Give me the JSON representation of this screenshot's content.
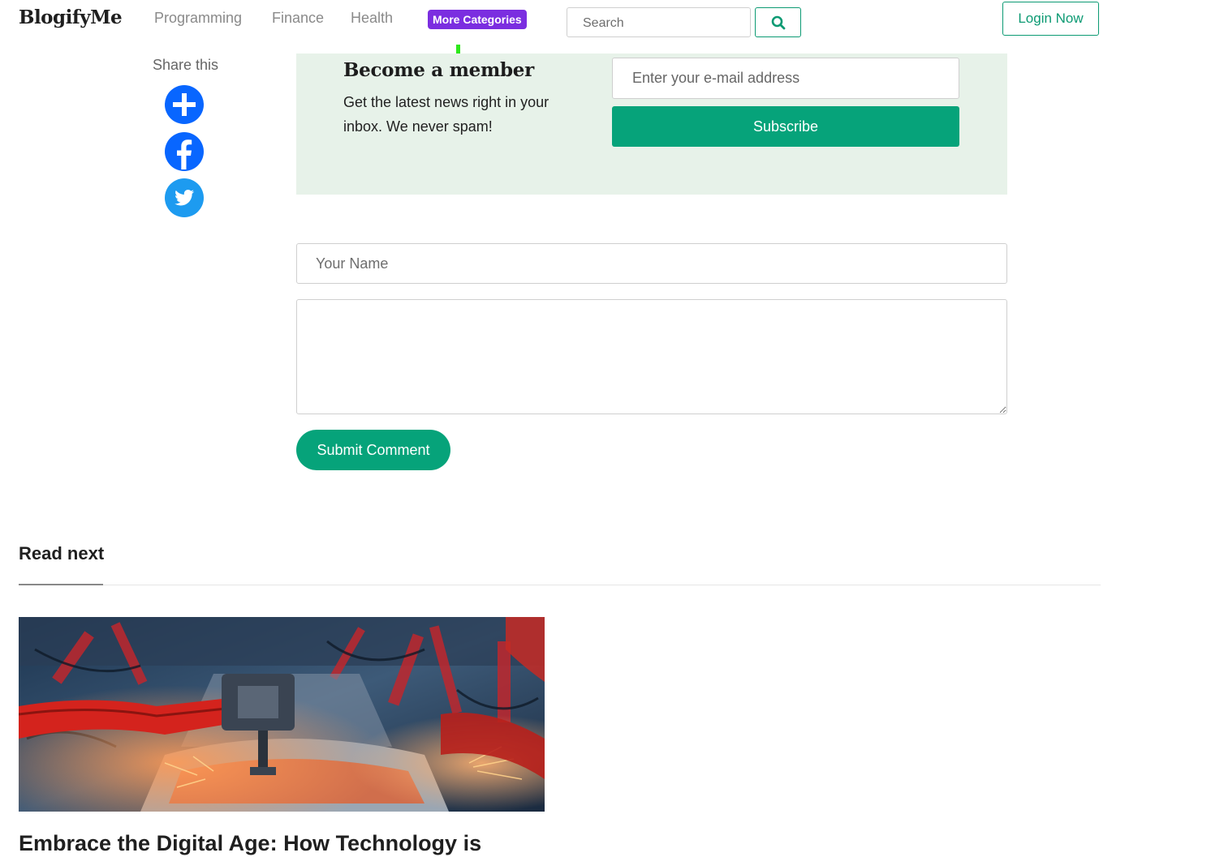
{
  "header": {
    "brand": "BlogifyMe",
    "nav": {
      "programming": "Programming",
      "finance": "Finance",
      "health": "Health",
      "more_categories": "More Categories"
    },
    "search": {
      "placeholder": "Search",
      "button_icon": "search-icon"
    },
    "login_label": "Login Now"
  },
  "share": {
    "title": "Share this",
    "icons": [
      "plus-share-icon",
      "facebook-icon",
      "twitter-icon"
    ]
  },
  "newsletter": {
    "title": "Become a member",
    "text": "Get the latest news right in your inbox. We never spam!",
    "email_placeholder": "Enter your e-mail address",
    "subscribe_label": "Subscribe"
  },
  "comment_form": {
    "name_placeholder": "Your Name",
    "comment_value": "",
    "submit_label": "Submit Comment"
  },
  "read_next": {
    "heading": "Read next",
    "article_title": "Embrace the Digital Age: How Technology is"
  },
  "colors": {
    "accent_green": "#06a37a",
    "badge_purple": "#7b2ee0",
    "newsletter_bg": "#e7f2e9",
    "share_blue": "#0866ff",
    "twitter_blue": "#1d9bf0"
  }
}
